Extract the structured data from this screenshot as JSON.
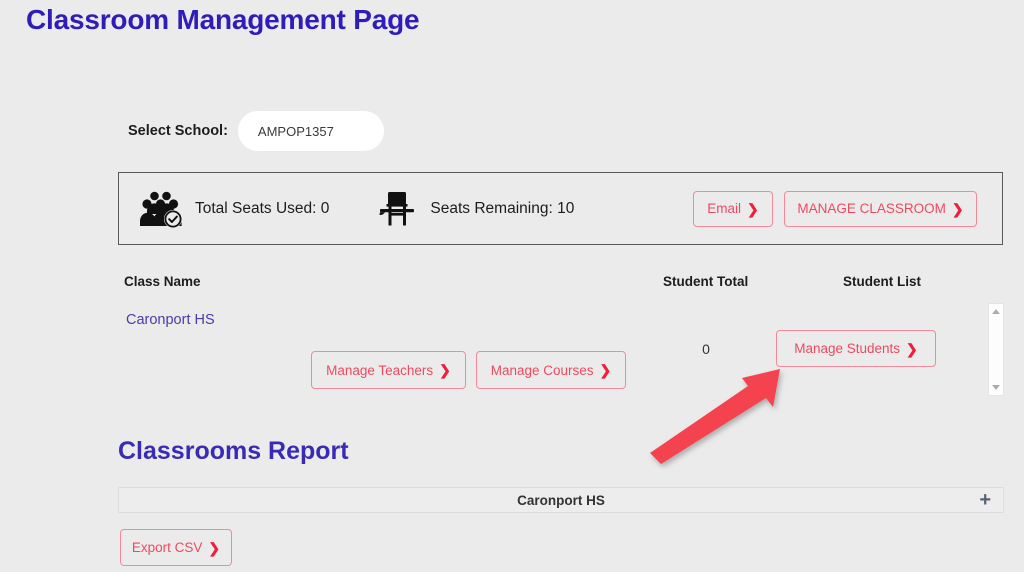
{
  "page": {
    "title": "Classroom Management Page",
    "background_color": "#ebebeb",
    "title_color": "#2e1db8"
  },
  "select_school": {
    "label": "Select School:",
    "selected_value": "AMPOP1357",
    "options": [
      "AMPOP1357"
    ]
  },
  "seats_summary": {
    "total_seats_used_text": "Total Seats Used: 0",
    "total_seats_used_value": 0,
    "seats_remaining_text": "Seats Remaining: 10",
    "seats_remaining_value": 10,
    "people_icon": "group-of-people-check-icon",
    "desk_icon": "school-desk-icon",
    "email_button": "Email",
    "manage_classroom_button": "MANAGE CLASSROOM",
    "chevron": "❯"
  },
  "class_table": {
    "columns": {
      "class_name": "Class Name",
      "student_total": "Student Total",
      "student_list": "Student List"
    },
    "rows": [
      {
        "class_name": "Caronport HS",
        "manage_teachers_button": "Manage Teachers",
        "manage_courses_button": "Manage Courses",
        "student_total": "0",
        "manage_students_button": "Manage Students"
      }
    ]
  },
  "classrooms_report": {
    "heading": "Classrooms Report",
    "accordion_label": "Caronport HS",
    "accordion_expand_icon": "+",
    "export_csv_button": "Export CSV"
  },
  "annotation": {
    "arrow_color": "#f4424f",
    "points_to": "Manage Students"
  },
  "theme": {
    "button_border": "#f4899b",
    "button_text": "#f0495f",
    "chevron_color": "#f01e3c",
    "link_color": "#4b3ca8"
  }
}
